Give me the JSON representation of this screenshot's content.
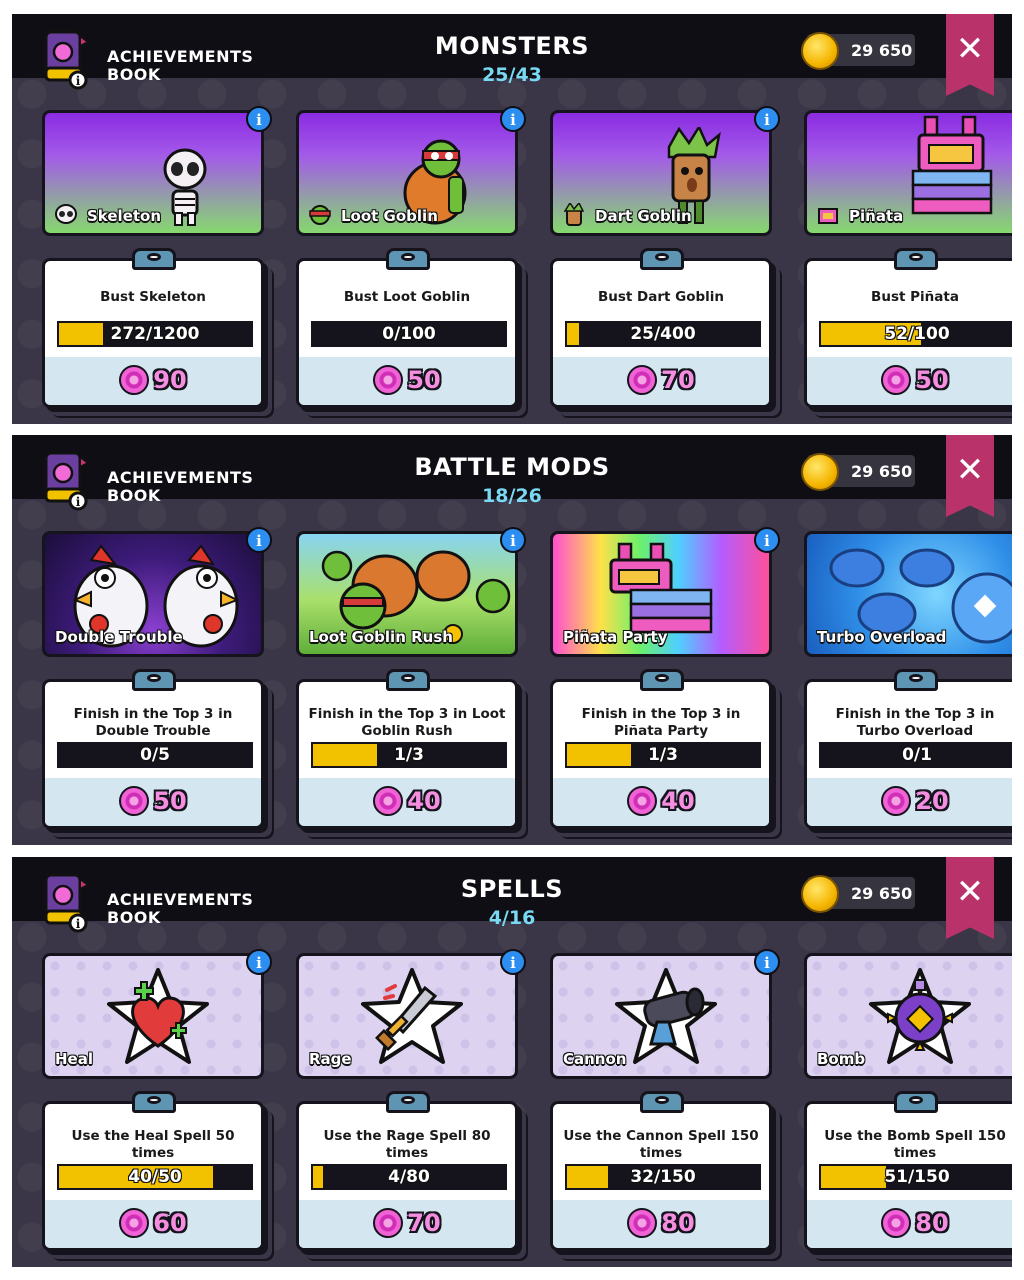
{
  "book_label_line1": "ACHIEVEMENTS",
  "book_label_line2": "BOOK",
  "coins": "29 650",
  "close_label": "✕",
  "info_label": "i",
  "sections": [
    {
      "title": "MONSTERS",
      "count": "25/43",
      "cards": [
        {
          "name": "Skeleton",
          "task": "Bust Skeleton",
          "progress": "272/1200",
          "fraction": 0.227,
          "reward": "90"
        },
        {
          "name": "Loot Goblin",
          "task": "Bust Loot Goblin",
          "progress": "0/100",
          "fraction": 0.0,
          "reward": "50"
        },
        {
          "name": "Dart Goblin",
          "task": "Bust Dart Goblin",
          "progress": "25/400",
          "fraction": 0.0625,
          "reward": "70"
        },
        {
          "name": "Piñata",
          "task": "Bust Piñata",
          "progress": "52/100",
          "fraction": 0.52,
          "reward": "50"
        }
      ]
    },
    {
      "title": "BATTLE MODS",
      "count": "18/26",
      "cards": [
        {
          "name": "Double Trouble",
          "task": "Finish in the Top 3 in Double Trouble",
          "progress": "0/5",
          "fraction": 0.0,
          "reward": "50"
        },
        {
          "name": "Loot Goblin Rush",
          "task": "Finish in the Top 3 in Loot Goblin Rush",
          "progress": "1/3",
          "fraction": 0.333,
          "reward": "40"
        },
        {
          "name": "Piñata Party",
          "task": "Finish in the Top 3 in Piñata Party",
          "progress": "1/3",
          "fraction": 0.333,
          "reward": "40"
        },
        {
          "name": "Turbo Overload",
          "task": "Finish in the Top 3 in Turbo Overload",
          "progress": "0/1",
          "fraction": 0.0,
          "reward": "20"
        }
      ]
    },
    {
      "title": "SPELLS",
      "count": "4/16",
      "cards": [
        {
          "name": "Heal",
          "task": "Use the Heal Spell 50 times",
          "progress": "40/50",
          "fraction": 0.8,
          "reward": "60"
        },
        {
          "name": "Rage",
          "task": "Use the Rage Spell 80 times",
          "progress": "4/80",
          "fraction": 0.05,
          "reward": "70"
        },
        {
          "name": "Cannon",
          "task": "Use the Cannon Spell 150 times",
          "progress": "32/150",
          "fraction": 0.213,
          "reward": "80"
        },
        {
          "name": "Bomb",
          "task": "Use the Bomb Spell 150 times",
          "progress": "51/150",
          "fraction": 0.34,
          "reward": "80"
        }
      ]
    }
  ]
}
